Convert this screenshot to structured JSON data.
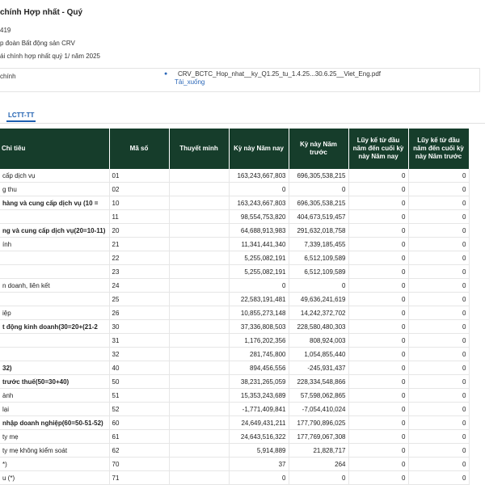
{
  "page": {
    "title": "chính Hợp nhất - Quý",
    "ticker_fragment": "419",
    "company_fragment": "p đoàn Bất động sản CRV",
    "period_fragment": "ái chính hợp nhất quý 1/ năm 2025"
  },
  "attachment": {
    "label": "chính",
    "file_name": "CRV_BCTC_Hop_nhat__ky_Q1.25_tu_1.4.25...30.6.25__Viet_Eng.pdf",
    "download_label": "Tải_xuống"
  },
  "tabs": [
    {
      "label": "LCTT-TT",
      "active": true
    }
  ],
  "table": {
    "headers": {
      "name": "Chỉ tiêu",
      "code": "Mã số",
      "note": "Thuyết minh",
      "current": "Kỳ này Năm nay",
      "previous": "Kỳ này Năm trước",
      "ytd_current": "Lũy kế từ đầu năm đến cuối kỳ này Năm nay",
      "ytd_previous": "Lũy kế từ đầu năm đến cuối kỳ này Năm trước"
    },
    "rows": [
      {
        "name": "cấp dịch vụ",
        "code": "01",
        "note": "",
        "current": "163,243,667,803",
        "previous": "696,305,538,215",
        "ytd_current": "0",
        "ytd_previous": "0",
        "bold": false
      },
      {
        "name": "g thu",
        "code": "02",
        "note": "",
        "current": "0",
        "previous": "0",
        "ytd_current": "0",
        "ytd_previous": "0",
        "bold": false
      },
      {
        "name": "hàng và cung cấp dịch vụ (10 =",
        "code": "10",
        "note": "",
        "current": "163,243,667,803",
        "previous": "696,305,538,215",
        "ytd_current": "0",
        "ytd_previous": "0",
        "bold": true
      },
      {
        "name": "",
        "code": "11",
        "note": "",
        "current": "98,554,753,820",
        "previous": "404,673,519,457",
        "ytd_current": "0",
        "ytd_previous": "0",
        "bold": false
      },
      {
        "name": "ng và cung cấp dịch vụ(20=10-11)",
        "code": "20",
        "note": "",
        "current": "64,688,913,983",
        "previous": "291,632,018,758",
        "ytd_current": "0",
        "ytd_previous": "0",
        "bold": true
      },
      {
        "name": "ính",
        "code": "21",
        "note": "",
        "current": "11,341,441,340",
        "previous": "7,339,185,455",
        "ytd_current": "0",
        "ytd_previous": "0",
        "bold": false
      },
      {
        "name": "",
        "code": "22",
        "note": "",
        "current": "5,255,082,191",
        "previous": "6,512,109,589",
        "ytd_current": "0",
        "ytd_previous": "0",
        "bold": false
      },
      {
        "name": "",
        "code": "23",
        "note": "",
        "current": "5,255,082,191",
        "previous": "6,512,109,589",
        "ytd_current": "0",
        "ytd_previous": "0",
        "bold": false
      },
      {
        "name": "n doanh, liên kết",
        "code": "24",
        "note": "",
        "current": "0",
        "previous": "0",
        "ytd_current": "0",
        "ytd_previous": "0",
        "bold": false
      },
      {
        "name": "",
        "code": "25",
        "note": "",
        "current": "22,583,191,481",
        "previous": "49,636,241,619",
        "ytd_current": "0",
        "ytd_previous": "0",
        "bold": false
      },
      {
        "name": "iệp",
        "code": "26",
        "note": "",
        "current": "10,855,273,148",
        "previous": "14,242,372,702",
        "ytd_current": "0",
        "ytd_previous": "0",
        "bold": false
      },
      {
        "name": "t động kinh doanh(30=20+(21-2",
        "code": "30",
        "note": "",
        "current": "37,336,808,503",
        "previous": "228,580,480,303",
        "ytd_current": "0",
        "ytd_previous": "0",
        "bold": true
      },
      {
        "name": "",
        "code": "31",
        "note": "",
        "current": "1,176,202,356",
        "previous": "808,924,003",
        "ytd_current": "0",
        "ytd_previous": "0",
        "bold": false
      },
      {
        "name": "",
        "code": "32",
        "note": "",
        "current": "281,745,800",
        "previous": "1,054,855,440",
        "ytd_current": "0",
        "ytd_previous": "0",
        "bold": false
      },
      {
        "name": "32)",
        "code": "40",
        "note": "",
        "current": "894,456,556",
        "previous": "-245,931,437",
        "ytd_current": "0",
        "ytd_previous": "0",
        "bold": true
      },
      {
        "name": "trước thuế(50=30+40)",
        "code": "50",
        "note": "",
        "current": "38,231,265,059",
        "previous": "228,334,548,866",
        "ytd_current": "0",
        "ytd_previous": "0",
        "bold": true
      },
      {
        "name": "ành",
        "code": "51",
        "note": "",
        "current": "15,353,243,689",
        "previous": "57,598,062,865",
        "ytd_current": "0",
        "ytd_previous": "0",
        "bold": false
      },
      {
        "name": "lại",
        "code": "52",
        "note": "",
        "current": "-1,771,409,841",
        "previous": "-7,054,410,024",
        "ytd_current": "0",
        "ytd_previous": "0",
        "bold": false
      },
      {
        "name": "nhập doanh nghiệp(60=50-51-52)",
        "code": "60",
        "note": "",
        "current": "24,649,431,211",
        "previous": "177,790,896,025",
        "ytd_current": "0",
        "ytd_previous": "0",
        "bold": true
      },
      {
        "name": "ty mẹ",
        "code": "61",
        "note": "",
        "current": "24,643,516,322",
        "previous": "177,769,067,308",
        "ytd_current": "0",
        "ytd_previous": "0",
        "bold": false
      },
      {
        "name": "ty mẹ không kiểm soát",
        "code": "62",
        "note": "",
        "current": "5,914,889",
        "previous": "21,828,717",
        "ytd_current": "0",
        "ytd_previous": "0",
        "bold": false
      },
      {
        "name": "*)",
        "code": "70",
        "note": "",
        "current": "37",
        "previous": "264",
        "ytd_current": "0",
        "ytd_previous": "0",
        "bold": false
      },
      {
        "name": "u (*)",
        "code": "71",
        "note": "",
        "current": "0",
        "previous": "0",
        "ytd_current": "0",
        "ytd_previous": "0",
        "bold": false
      }
    ]
  },
  "colors": {
    "header_bg": "#163d2b",
    "link": "#2a67b8",
    "tab_active": "#1d5fb0"
  }
}
